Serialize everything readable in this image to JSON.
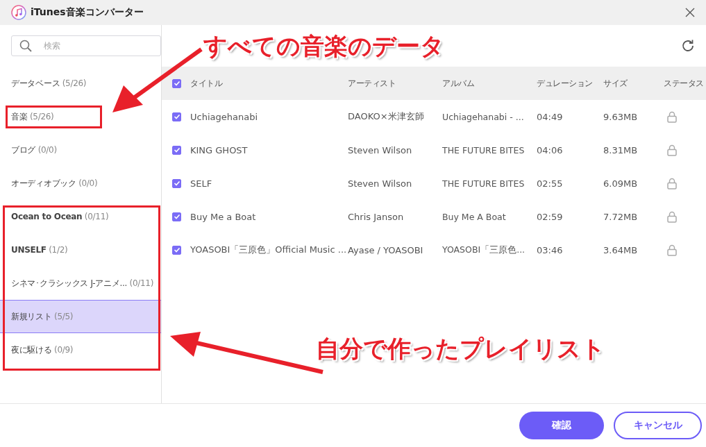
{
  "window": {
    "title": "iTunes音楽コンバーター"
  },
  "search": {
    "placeholder": "検索"
  },
  "sidebar": {
    "items": [
      {
        "name": "データベース",
        "count": "(5/26)",
        "bold": false,
        "selected": false
      },
      {
        "name": "音楽",
        "count": "(5/26)",
        "bold": false,
        "selected": false
      },
      {
        "name": "ブログ",
        "count": "(0/0)",
        "bold": false,
        "selected": false
      },
      {
        "name": "オーディオブック",
        "count": "(0/0)",
        "bold": false,
        "selected": false
      },
      {
        "name": "Ocean to Ocean",
        "count": "(0/11)",
        "bold": true,
        "selected": false
      },
      {
        "name": "UNSELF",
        "count": "(1/2)",
        "bold": true,
        "selected": false
      },
      {
        "name": "シネマ･クラシックス J-アニメ...",
        "count": "(0/11)",
        "bold": false,
        "selected": false
      },
      {
        "name": "新規リスト",
        "count": "(5/5)",
        "bold": false,
        "selected": true
      },
      {
        "name": "夜に駆ける",
        "count": "(0/9)",
        "bold": false,
        "selected": false
      }
    ]
  },
  "table": {
    "all_checked": true,
    "columns": [
      "タイトル",
      "アーティスト",
      "アルバム",
      "デュレーション",
      "サイズ",
      "ステータス"
    ],
    "rows": [
      {
        "checked": true,
        "cells": [
          "Uchiagehanabi",
          "DAOKO×米津玄師",
          "Uchiagehanabi - ...",
          "04:49",
          "9.63MB"
        ]
      },
      {
        "checked": true,
        "cells": [
          "KING GHOST",
          "Steven Wilson",
          "THE FUTURE BITES",
          "04:06",
          "8.31MB"
        ]
      },
      {
        "checked": true,
        "cells": [
          "SELF",
          "Steven Wilson",
          "THE FUTURE BITES",
          "02:55",
          "6.09MB"
        ]
      },
      {
        "checked": true,
        "cells": [
          "Buy Me a Boat",
          "Chris Janson",
          "Buy Me A Boat",
          "02:59",
          "7.72MB"
        ]
      },
      {
        "checked": true,
        "cells": [
          "YOASOBI「三原色」Official Music ...",
          "Ayase / YOASOBI",
          "YOASOBI「三原色...",
          "03:46",
          "3.64MB"
        ]
      }
    ]
  },
  "buttons": [
    "確認",
    "キャンセル"
  ],
  "annotations": [
    {
      "text": "すべての音楽のデータ"
    },
    {
      "text": "自分で作ったプレイリスト"
    }
  ]
}
